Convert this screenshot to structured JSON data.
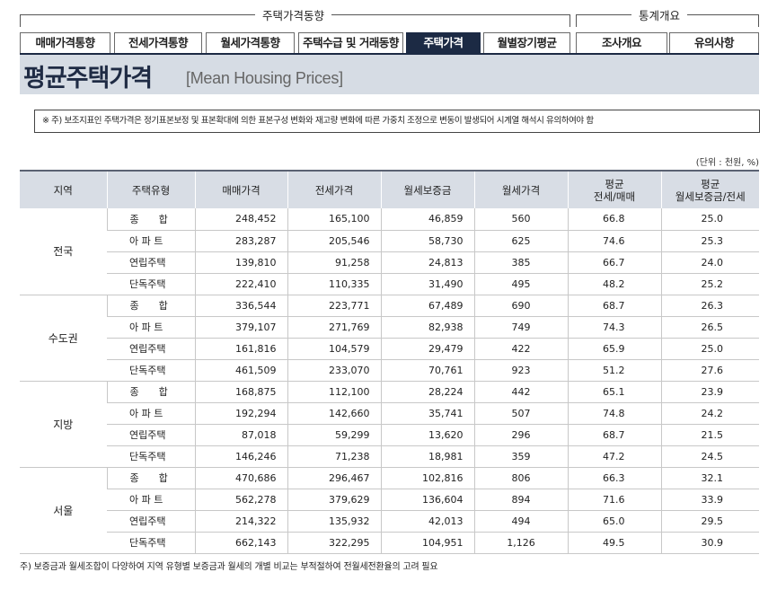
{
  "nav": {
    "group1_title": "주택가격동향",
    "group2_title": "통계개요",
    "tabs": [
      {
        "label": "매매가격통향",
        "active": false
      },
      {
        "label": "전세가격통향",
        "active": false
      },
      {
        "label": "월세가격통향",
        "active": false
      },
      {
        "label": "주택수급 및 거래동향",
        "active": false
      },
      {
        "label": "주택가격",
        "active": true
      },
      {
        "label": "월별장기평균",
        "active": false
      },
      {
        "label": "조사개요",
        "active": false
      },
      {
        "label": "유의사항",
        "active": false
      }
    ]
  },
  "banner": {
    "title_ko": "평균주택가격",
    "title_en": "[Mean Housing Prices]"
  },
  "notice": "※ 주) 보조지표인 주택가격은 정기표본보정 및 표본확대에 의한 표본구성 변화와 재고량 변화에 따른 가중치 조정으로 변동이 발생되어 시계열 해석시 유의하여야 함",
  "unit": "(단위 : 천원, %)",
  "table": {
    "headers": [
      "지역",
      "주택유형",
      "매매가격",
      "전세가격",
      "월세보증금",
      "월세가격",
      "평균\n전세/매매",
      "평균\n월세보증금/전세"
    ],
    "groups": [
      {
        "region": "전국",
        "rows": [
          [
            "종　　합",
            "248,452",
            "165,100",
            "46,859",
            "560",
            "66.8",
            "25.0"
          ],
          [
            "아 파 트",
            "283,287",
            "205,546",
            "58,730",
            "625",
            "74.6",
            "25.3"
          ],
          [
            "연립주택",
            "139,810",
            "91,258",
            "24,813",
            "385",
            "66.7",
            "24.0"
          ],
          [
            "단독주택",
            "222,410",
            "110,335",
            "31,490",
            "495",
            "48.2",
            "25.2"
          ]
        ]
      },
      {
        "region": "수도권",
        "rows": [
          [
            "종　　합",
            "336,544",
            "223,771",
            "67,489",
            "690",
            "68.7",
            "26.3"
          ],
          [
            "아 파 트",
            "379,107",
            "271,769",
            "82,938",
            "749",
            "74.3",
            "26.5"
          ],
          [
            "연립주택",
            "161,816",
            "104,579",
            "29,479",
            "422",
            "65.9",
            "25.0"
          ],
          [
            "단독주택",
            "461,509",
            "233,070",
            "70,761",
            "923",
            "51.2",
            "27.6"
          ]
        ]
      },
      {
        "region": "지방",
        "rows": [
          [
            "종　　합",
            "168,875",
            "112,100",
            "28,224",
            "442",
            "65.1",
            "23.9"
          ],
          [
            "아 파 트",
            "192,294",
            "142,660",
            "35,741",
            "507",
            "74.8",
            "24.2"
          ],
          [
            "연립주택",
            "87,018",
            "59,299",
            "13,620",
            "296",
            "68.7",
            "21.5"
          ],
          [
            "단독주택",
            "146,246",
            "71,238",
            "18,981",
            "359",
            "47.2",
            "24.5"
          ]
        ]
      },
      {
        "region": "서울",
        "rows": [
          [
            "종　　합",
            "470,686",
            "296,467",
            "102,816",
            "806",
            "66.3",
            "32.1"
          ],
          [
            "아 파 트",
            "562,278",
            "379,629",
            "136,604",
            "894",
            "71.6",
            "33.9"
          ],
          [
            "연립주택",
            "214,322",
            "135,932",
            "42,013",
            "494",
            "65.0",
            "29.5"
          ],
          [
            "단독주택",
            "662,143",
            "322,295",
            "104,951",
            "1,126",
            "49.5",
            "30.9"
          ]
        ]
      }
    ]
  },
  "footnote": "주) 보증금과 월세조합이 다양하여 지역 유형별 보증금과 월세의 개별 비교는 부적절하여 전월세전환율의 고려 필요"
}
